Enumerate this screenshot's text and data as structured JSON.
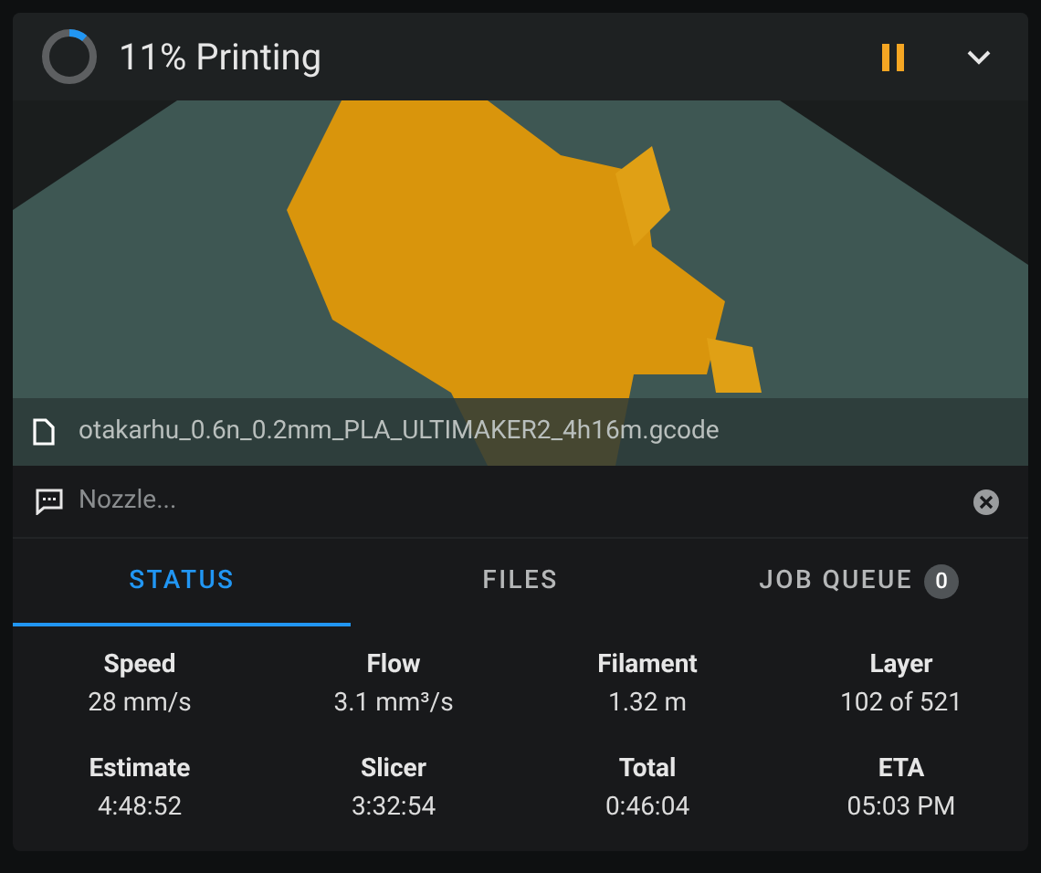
{
  "header": {
    "progress": {
      "level": 0.11
    },
    "title": "11% Printing"
  },
  "preview": {
    "filename": "otakarhu_0.6n_0.2mm_PLA_ULTIMAKER2_4h16m.gcode"
  },
  "console": {
    "placeholder": "Nozzle..."
  },
  "tabs": [
    {
      "label": "STATUS",
      "selected": true
    },
    {
      "label": "FILES",
      "selected": false
    },
    {
      "label": "JOB QUEUE",
      "selected": false,
      "badge": "0"
    }
  ],
  "stats": [
    {
      "label": "Speed",
      "value": "28 mm/s"
    },
    {
      "label": "Flow",
      "value": "3.1 mm³/s"
    },
    {
      "label": "Filament",
      "value": "1.32 m"
    },
    {
      "label": "Layer",
      "value": "102 of 521"
    },
    {
      "label": "Estimate",
      "value": "4:48:52"
    },
    {
      "label": "Slicer",
      "value": "3:32:54"
    },
    {
      "label": "Total",
      "value": "0:46:04"
    },
    {
      "label": "ETA",
      "value": "05:03 PM"
    }
  ]
}
